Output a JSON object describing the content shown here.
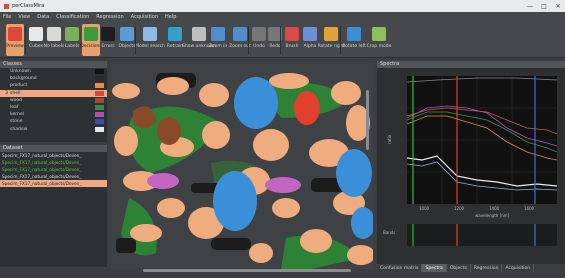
{
  "window": {
    "title": "perClassMira"
  },
  "menu": [
    "File",
    "View",
    "Data",
    "Classification",
    "Regression",
    "Acquisition",
    "Help"
  ],
  "toolbar": [
    {
      "label": "Preview",
      "color": "#e0463a",
      "active": true
    },
    {
      "label": "Cubes",
      "color": "#e8e8e8"
    },
    {
      "label": "No labels",
      "color": "#d9d9d9"
    },
    {
      "label": "Labels",
      "color": "#7bb15a"
    },
    {
      "label": "Decisions",
      "color": "#3c9a3e",
      "active": true
    },
    {
      "label": "Errors",
      "color": "#1e1e1e"
    },
    {
      "label": "Objects",
      "color": "#5a9bd6"
    },
    {
      "label": "Model search",
      "color": "#8bbbe6"
    },
    {
      "label": "Retrain",
      "color": "#34a0c9"
    },
    {
      "label": "Show unknown",
      "color": "#bfbfbf"
    },
    {
      "label": "Zoom in",
      "color": "#4f8fd0"
    },
    {
      "label": "Zoom out",
      "color": "#4f8fd0"
    },
    {
      "label": "Undo",
      "color": "#777"
    },
    {
      "label": "Redo",
      "color": "#777"
    },
    {
      "label": "Brush",
      "color": "#d94a4a"
    },
    {
      "label": "Alpha",
      "color": "#6b8fd9"
    },
    {
      "label": "Rotate right",
      "color": "#e0a338"
    },
    {
      "label": "Rotate left",
      "color": "#3b8fd4"
    },
    {
      "label": "Crop mode",
      "color": "#8dbf5a"
    }
  ],
  "classes": {
    "title": "Classes",
    "items": [
      {
        "idx": "",
        "name": "Unknown",
        "color": "#111111"
      },
      {
        "idx": "",
        "name": "background",
        "color": "#2a2a2a"
      },
      {
        "idx": "",
        "name": "product",
        "color": "#f08a3a"
      },
      {
        "idx": "3",
        "name": "shell",
        "color": "#d8473a",
        "selected": true
      },
      {
        "idx": "",
        "name": "wood",
        "color": "#a6472e"
      },
      {
        "idx": "",
        "name": "leaf",
        "color": "#2f8f3a"
      },
      {
        "idx": "",
        "name": "kernel",
        "color": "#b04fb5"
      },
      {
        "idx": "",
        "name": "stone",
        "color": "#3a4fb0"
      },
      {
        "idx": "",
        "name": "shadow",
        "color": "#e8e8e8"
      }
    ]
  },
  "dataset": {
    "title": "Dataset",
    "rows": [
      {
        "text": "Specim_FX17_natural_objects/Deven_",
        "kind": "w"
      },
      {
        "text": "Specim_FX17_natural_objects/Deven_",
        "kind": "g"
      },
      {
        "text": "Specim_FX17_natural_objects/Deven_",
        "kind": "g"
      },
      {
        "text": "Specim_FX17_natural_objects/Deven_",
        "kind": "w"
      },
      {
        "text": "Specim_FX17_natural_objects/Deven_",
        "kind": "sel"
      }
    ]
  },
  "spectra": {
    "title": "Spectra",
    "ylabel": "ratio",
    "xlabel": "wavelength [nm]",
    "ticks": [
      "1000",
      "1200",
      "1400",
      "1600"
    ],
    "bottom_label": "Bands"
  },
  "tabs": [
    "Confusion matrix",
    "Spectra",
    "Objects",
    "Regression",
    "Acquisition"
  ]
}
